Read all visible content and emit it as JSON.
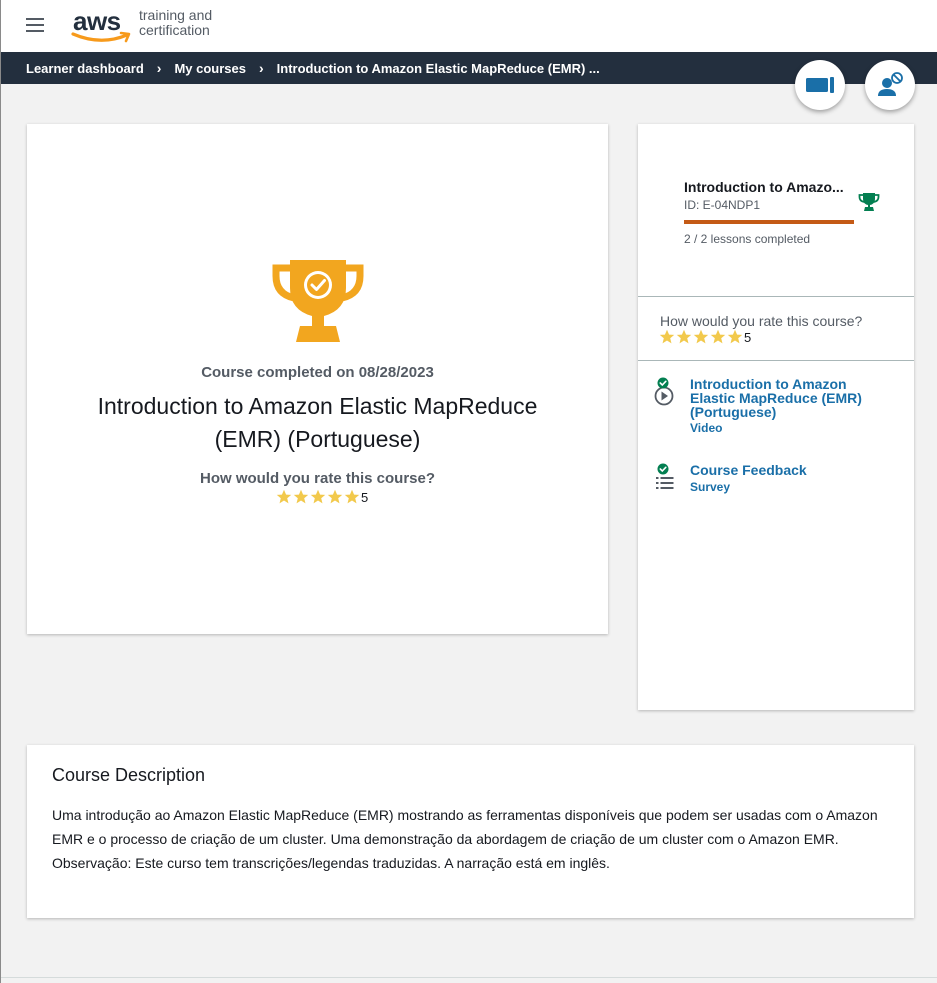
{
  "header": {
    "logo_aws": "aws",
    "logo_line1": "training and",
    "logo_line2": "certification",
    "menu_icon": "hamburger-menu-icon"
  },
  "breadcrumb": {
    "items": [
      "Learner dashboard",
      "My courses"
    ],
    "current": "Introduction to Amazon Elastic MapReduce (EMR) ...",
    "separator": ">"
  },
  "floating_buttons": {
    "transcript_icon": "video-transcript-icon",
    "accessibility_icon": "user-blocked-icon"
  },
  "main_card": {
    "completed_label": "Course completed on 08/28/2023",
    "course_title": "Introduction to Amazon Elastic MapReduce (EMR) (Portuguese)",
    "rate_question": "How would you rate this course?",
    "rating_value": "5",
    "rating_stars": 5,
    "trophy_color": "#f2a61f"
  },
  "side_card": {
    "course_title": "Introduction to Amazo...",
    "course_id": "ID: E-04NDP1",
    "progress_fraction": 1.0,
    "progress_color": "#c45a16",
    "lessons_completed": "2 / 2 lessons completed",
    "rate_question": "How would you rate this course?",
    "rating_value": "5",
    "rating_stars": 5,
    "lessons": [
      {
        "title": "Introduction to Amazon Elastic MapReduce (EMR) (Portuguese)",
        "type": "Video",
        "icon": "play-circle-icon",
        "status": "completed"
      },
      {
        "title": "Course Feedback",
        "type": "Survey",
        "icon": "survey-list-icon",
        "status": "completed"
      }
    ]
  },
  "description": {
    "heading": "Course Description",
    "paragraph1": "Uma introdução ao Amazon Elastic MapReduce (EMR) mostrando as ferramentas disponíveis que podem ser usadas com o Amazon EMR e o processo de criação de um cluster. Uma demonstração da abordagem de criação de um cluster com o Amazon EMR.",
    "paragraph2": "Observação: Este curso tem transcrições/legendas traduzidas. A narração está em inglês."
  },
  "colors": {
    "nav_bg": "#232f3e",
    "link": "#1a6fa8",
    "success": "#037f51",
    "star": "#f2c94c"
  }
}
